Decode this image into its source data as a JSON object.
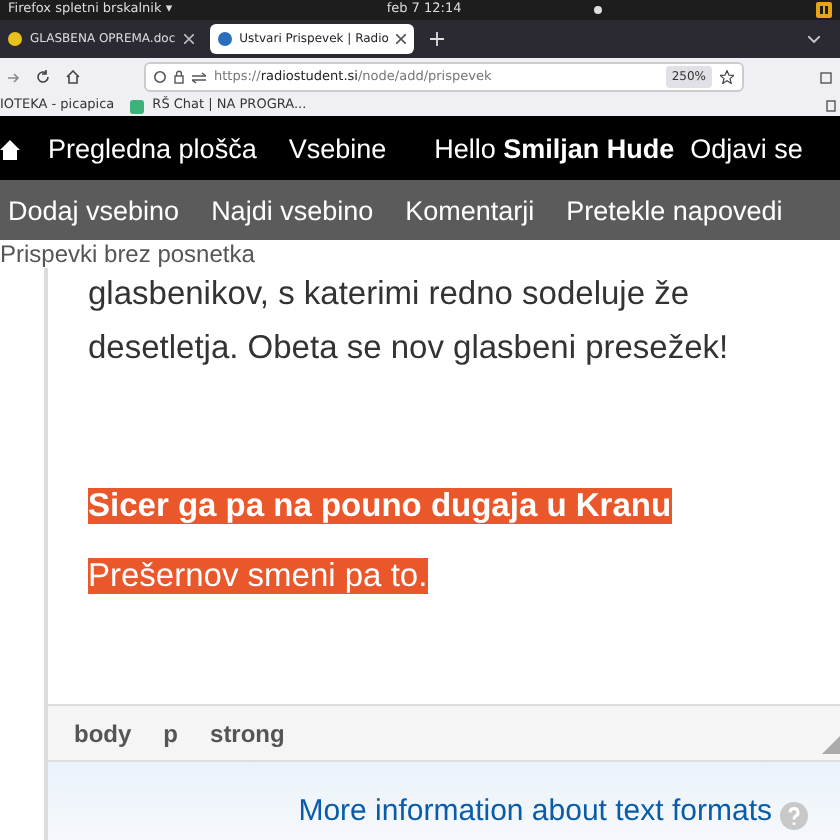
{
  "system_bar": {
    "app": "Firefox spletni brskalnik ▾",
    "clock": "feb 7  12:14"
  },
  "tabs": [
    {
      "title": "GLASBENA OPREMA.doc",
      "selected": false
    },
    {
      "title": "Ustvari Prispevek | Radio",
      "selected": true
    }
  ],
  "address_bar": {
    "url": "https://**radiostudent.si**/node/add/prispevek",
    "zoom": "250%"
  },
  "bookmarks": [
    "IOTEKA - picapica",
    "RŠ Chat | NA PROGRA..."
  ],
  "admin_menu": {
    "items": [
      "Pregledna plošča",
      "Vsebine"
    ],
    "greeting": "Hello **Smiljan Hude**",
    "logout": "Odjavi se"
  },
  "shortcuts": [
    "Dodaj vsebino",
    "Najdi vsebino",
    "Komentarji",
    "Pretekle napovedi",
    "Prispevki brez posnetka"
  ],
  "editor": {
    "paragraphs": [
      {
        "text": "glasbenikov, s katerimi redno sodeluje že desetletja. Obeta se nov glasbeni presežek!",
        "kind": "plain"
      },
      {
        "text": "Sicer ga pa na pouno dugaja u Kranu",
        "kind": "highlight-bold"
      },
      {
        "text": "Prešernov smeni pa to.",
        "kind": "highlight"
      }
    ],
    "path": [
      "body",
      "p",
      "strong"
    ]
  },
  "help_link": "More information about text formats"
}
